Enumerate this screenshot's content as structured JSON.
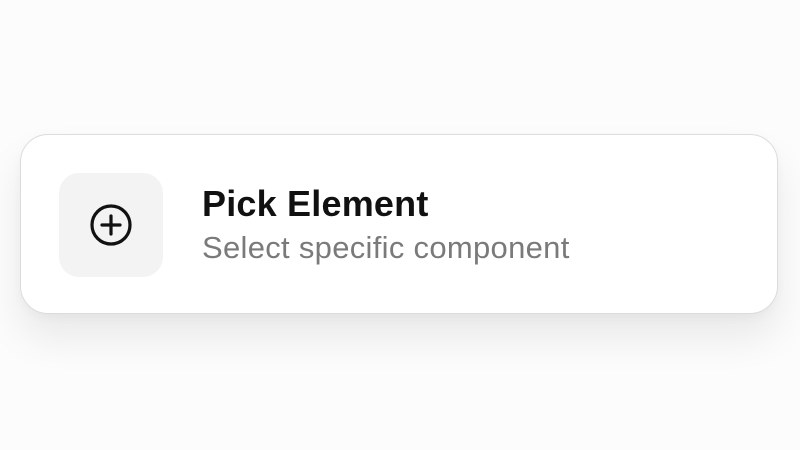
{
  "card": {
    "title": "Pick Element",
    "subtitle": "Select specific component",
    "icon": "plus-circle-icon"
  },
  "colors": {
    "background": "#fcfcfc",
    "card": "#ffffff",
    "icon_tile": "#f3f3f3",
    "title": "#111111",
    "subtitle": "#7a7a7a"
  }
}
